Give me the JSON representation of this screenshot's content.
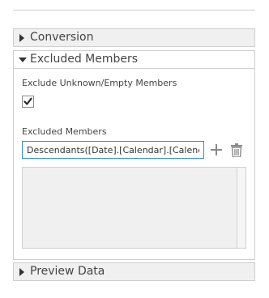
{
  "sections": {
    "conversion": {
      "title": "Conversion",
      "expanded": false
    },
    "excluded_members": {
      "title": "Excluded Members",
      "expanded": true,
      "exclude_unknown_label": "Exclude Unknown/Empty Members",
      "exclude_unknown_checked": true,
      "members_label": "Excluded Members",
      "member_input_value": "Descendants([Date].[Calendar].[Calendar",
      "members_list": []
    },
    "preview_data": {
      "title": "Preview Data",
      "expanded": false
    }
  },
  "icons": {
    "collapsed": "caret-right-icon",
    "expanded": "caret-down-icon",
    "add": "plus-icon",
    "delete": "trash-icon",
    "check": "checkmark-icon"
  },
  "colors": {
    "input_border": "#2b8fd6",
    "header_bg": "#f0f0f0",
    "border": "#cfcfcf",
    "icon_gray": "#8a8a8a"
  }
}
